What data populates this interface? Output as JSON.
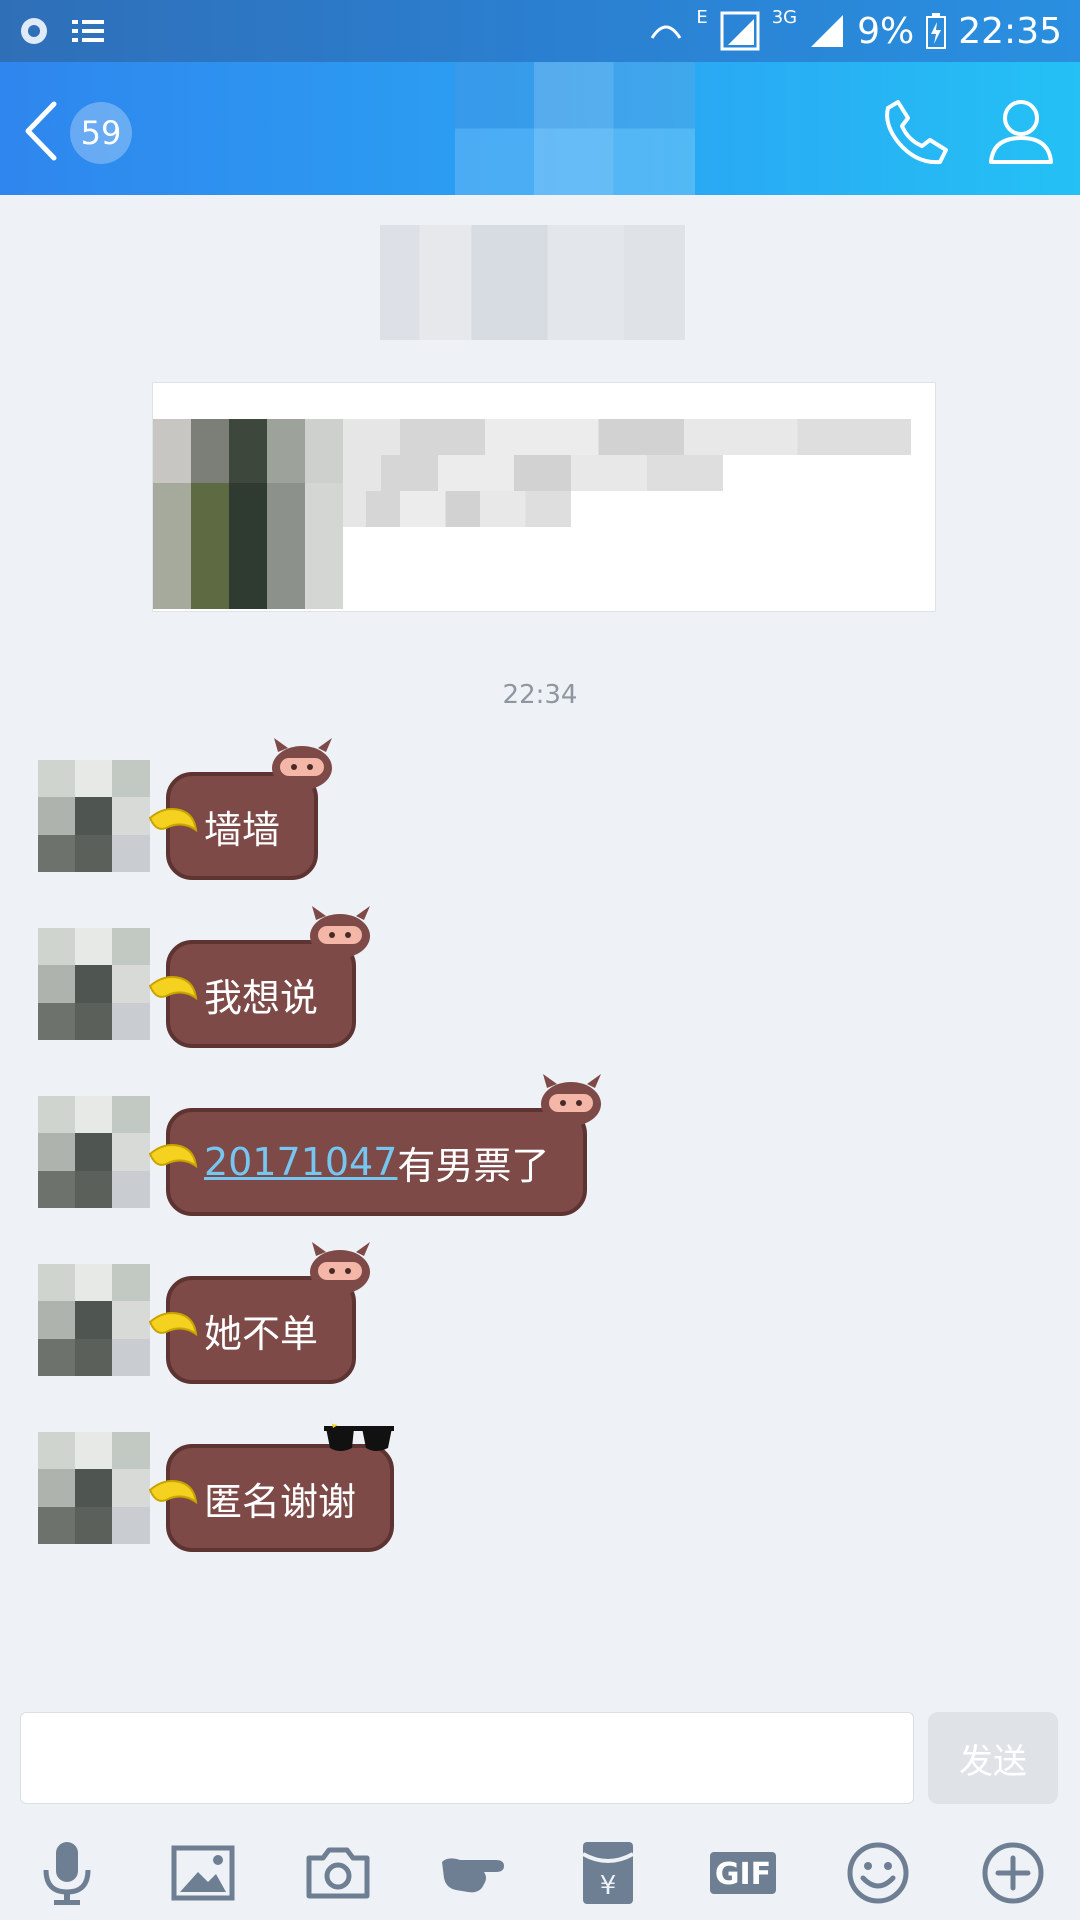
{
  "status_bar": {
    "network_e": "E",
    "network_3g": "3G",
    "battery": "9%",
    "time": "22:35"
  },
  "title_bar": {
    "unread_count": "59"
  },
  "chat": {
    "timestamp": "22:34",
    "messages": [
      {
        "text": "墙墙"
      },
      {
        "text": "我想说"
      },
      {
        "link": "20171047",
        "text": "有男票了"
      },
      {
        "text": "她不单"
      },
      {
        "text": "匿名谢谢"
      }
    ]
  },
  "input": {
    "placeholder": "",
    "send_label": "发送"
  },
  "toolbar": {
    "items": [
      "microphone-icon",
      "image-icon",
      "camera-icon",
      "poke-icon",
      "red-packet-icon",
      "gif-icon",
      "emoji-icon",
      "plus-icon"
    ],
    "gif_label": "GIF",
    "red_packet_label": "¥"
  },
  "colors": {
    "header_start": "#2f86ee",
    "header_end": "#24c1f5",
    "bubble": "#7d4a48",
    "link": "#76c6f2",
    "background": "#eef2f6"
  }
}
